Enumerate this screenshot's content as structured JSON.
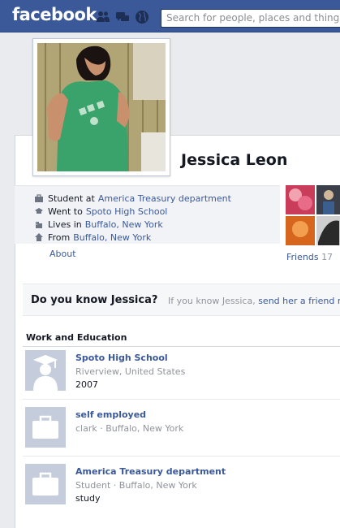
{
  "topbar": {
    "logo": "facebook",
    "search_placeholder": "Search for people, places and things",
    "jewels": [
      "friend-requests-icon",
      "messages-icon",
      "notifications-globe-icon"
    ]
  },
  "profile": {
    "name": "Jessica Leon",
    "info": [
      {
        "icon": "briefcase-icon",
        "prefix": "Student at",
        "link1": "America Treasury department",
        "link2": ""
      },
      {
        "icon": "graduation-icon",
        "prefix": "Went to",
        "link1": "Spoto High School",
        "link2": ""
      },
      {
        "icon": "building-icon",
        "prefix": "Lives in",
        "link1": "Buffalo, New York",
        "link2": ""
      },
      {
        "icon": "home-icon",
        "prefix": "From",
        "link1": "Buffalo, New York",
        "link2": ""
      }
    ],
    "about_link": "About",
    "friends_label": "Friends",
    "friends_count": "17"
  },
  "know_bar": {
    "title": "Do you know Jessica?",
    "sub_text": "If you know Jessica,",
    "sub_link": "send her a friend request"
  },
  "work_education": {
    "title": "Work and Education",
    "items": [
      {
        "icon": "school-icon",
        "title": "Spoto High School",
        "sub": "Riverview, United States",
        "extra": "2007"
      },
      {
        "icon": "briefcase-icon",
        "title": "self employed",
        "sub": "clark · Buffalo, New York",
        "extra": ""
      },
      {
        "icon": "briefcase-icon",
        "title": "America Treasury department",
        "sub": "Student · Buffalo, New York",
        "extra": "study"
      }
    ]
  },
  "colors": {
    "brand_blue": "#3b5998",
    "link_blue": "#3b5998",
    "muted_gray": "#90949c",
    "page_bg": "#e9ebee"
  }
}
